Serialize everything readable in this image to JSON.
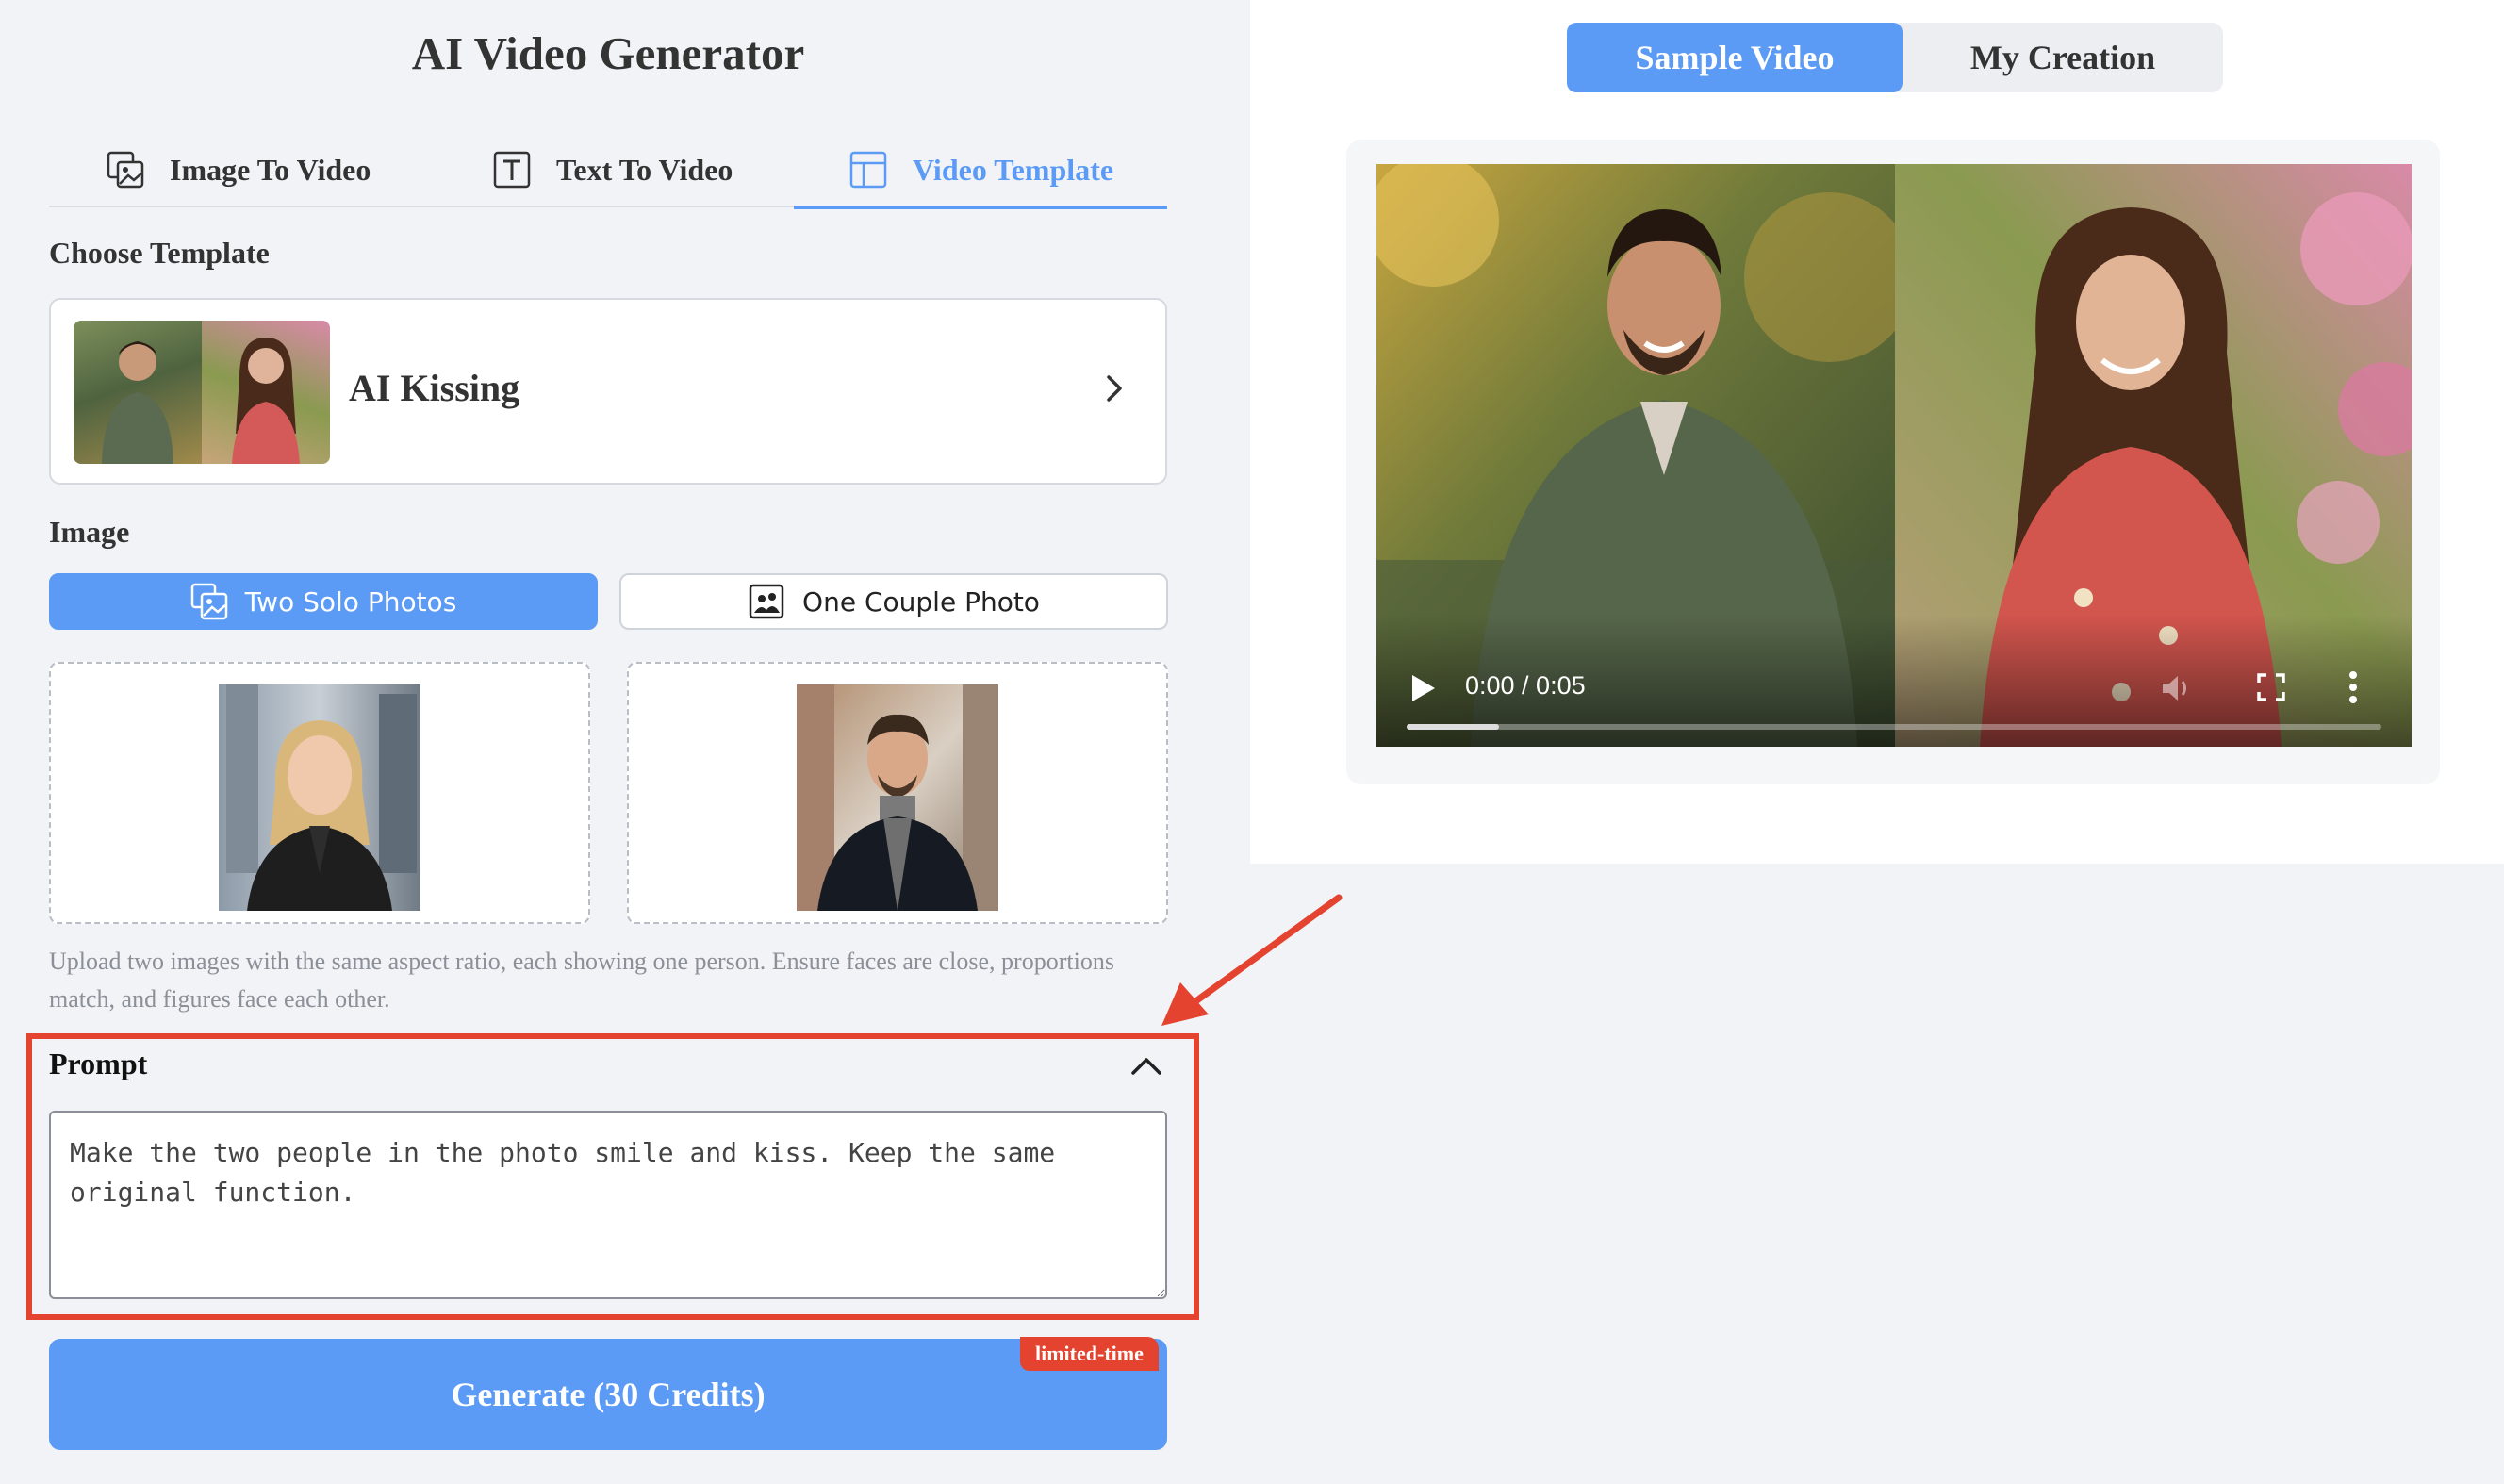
{
  "app_title": "AI Video Generator",
  "tabs": [
    {
      "label": "Image To Video",
      "icon": "image-to-video-icon",
      "active": false
    },
    {
      "label": "Text To Video",
      "icon": "text-icon",
      "active": false
    },
    {
      "label": "Video Template",
      "icon": "template-icon",
      "active": true
    }
  ],
  "template": {
    "section_label": "Choose Template",
    "selected_name": "AI Kissing"
  },
  "image": {
    "section_label": "Image",
    "options": [
      {
        "label": "Two Solo Photos",
        "selected": true
      },
      {
        "label": "One Couple Photo",
        "selected": false
      }
    ],
    "hint": "Upload two images with the same aspect ratio, each showing one person. Ensure faces are close, proportions match, and figures face each other."
  },
  "prompt": {
    "label": "Prompt",
    "value": "Make the two people in the photo smile and kiss. Keep the same original function."
  },
  "generate": {
    "label": "Generate (30 Credits)",
    "badge": "limited-time"
  },
  "preview": {
    "tabs": [
      {
        "label": "Sample Video",
        "active": true
      },
      {
        "label": "My Creation",
        "active": false
      }
    ],
    "player": {
      "time": "0:00 / 0:05",
      "progress_fraction": 0.095
    }
  },
  "colors": {
    "accent": "#5b9bf5",
    "highlight": "#e4432f"
  }
}
